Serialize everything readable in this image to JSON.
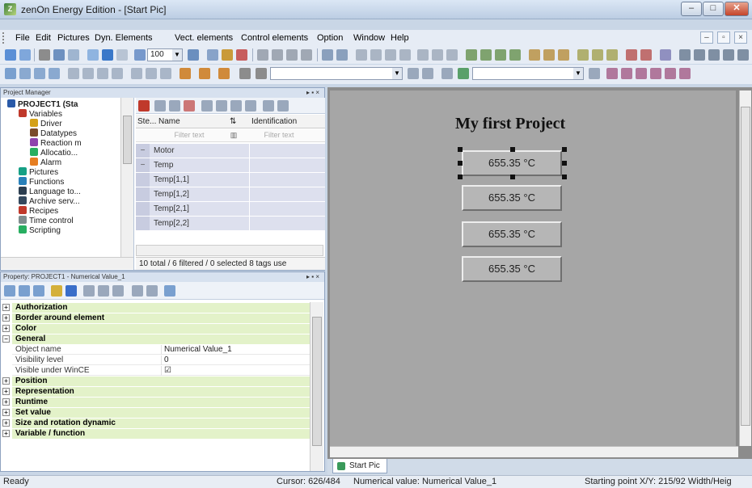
{
  "window": {
    "title": "zenOn Energy Edition - [Start Pic]",
    "app_icon_glyph": "Z",
    "minimize_glyph": "–",
    "maximize_glyph": "□",
    "close_glyph": "✕"
  },
  "menu": {
    "items": [
      "File",
      "Edit",
      "Pictures",
      "Dyn. Elements",
      "Vect. elements",
      "Control elements",
      "Option",
      "Window",
      "Help"
    ],
    "mdi": [
      "–",
      "▫",
      "×"
    ]
  },
  "toolbar": {
    "zoom_value": "100"
  },
  "project_manager": {
    "title": "Project Manager",
    "controls": "▸ ▪ ×",
    "tree": [
      {
        "label": "PROJECT1 (Sta",
        "icon": "project-icon",
        "color": "#2a5aa8",
        "bold": true
      },
      {
        "label": "Variables",
        "icon": "variables-icon",
        "color": "#c0392b"
      },
      {
        "label": "Driver",
        "icon": "driver-icon",
        "color": "#d4a017"
      },
      {
        "label": "Datatypes",
        "icon": "datatypes-icon",
        "color": "#7a4b2a"
      },
      {
        "label": "Reaction m",
        "icon": "reaction-icon",
        "color": "#8e44ad"
      },
      {
        "label": "Allocatio...",
        "icon": "allocation-icon",
        "color": "#27ae60"
      },
      {
        "label": "Alarm",
        "icon": "alarm-icon",
        "color": "#e67e22"
      },
      {
        "label": "Pictures",
        "icon": "pictures-icon",
        "color": "#16a085"
      },
      {
        "label": "Functions",
        "icon": "functions-icon",
        "color": "#2980b9"
      },
      {
        "label": "Language to...",
        "icon": "language-icon",
        "color": "#2c3e50"
      },
      {
        "label": "Archive serv...",
        "icon": "archive-icon",
        "color": "#34495e"
      },
      {
        "label": "Recipes",
        "icon": "recipes-icon",
        "color": "#c0392b"
      },
      {
        "label": "Time control",
        "icon": "clock-icon",
        "color": "#7f8c8d"
      },
      {
        "label": "Scripting",
        "icon": "scripting-icon",
        "color": "#27ae60"
      }
    ],
    "columns": [
      "Ste...",
      "Name",
      "Identification"
    ],
    "filter_placeholder": "Filter text",
    "variables": [
      "Motor",
      "Temp",
      "Temp[1,1]",
      "Temp[1,2]",
      "Temp[2,1]",
      "Temp[2,2]"
    ],
    "status": "10 total / 6 filtered / 0 selected  8 tags use"
  },
  "properties": {
    "title": "Property: PROJECT1 - Numerical Value_1",
    "controls": "▸ ▪ ×",
    "rows": [
      {
        "type": "cat",
        "label": "Authorization",
        "exp": "+"
      },
      {
        "type": "cat",
        "label": "Border around element",
        "exp": "+"
      },
      {
        "type": "cat",
        "label": "Color",
        "exp": "+"
      },
      {
        "type": "cat",
        "label": "General",
        "exp": "−"
      },
      {
        "type": "prop",
        "key": "Object name",
        "value": "Numerical Value_1"
      },
      {
        "type": "prop",
        "key": "Visibility level",
        "value": "0"
      },
      {
        "type": "prop",
        "key": "Visible under WinCE",
        "value": "☑"
      },
      {
        "type": "cat",
        "label": "Position",
        "exp": "+"
      },
      {
        "type": "cat",
        "label": "Representation",
        "exp": "+"
      },
      {
        "type": "cat",
        "label": "Runtime",
        "exp": "+"
      },
      {
        "type": "cat",
        "label": "Set value",
        "exp": "+"
      },
      {
        "type": "cat",
        "label": "Size and rotation dynamic",
        "exp": "+"
      },
      {
        "type": "cat",
        "label": "Variable / function",
        "exp": "+"
      }
    ]
  },
  "editor": {
    "picture_title": "My first Project",
    "values": [
      "655.35  °C",
      "655.35  °C",
      "655.35  °C",
      "655.35  °C"
    ],
    "tab": "Start Pic"
  },
  "statusbar": {
    "ready": "Ready",
    "cursor": "Cursor: 626/484",
    "numerical": "Numerical value: Numerical Value_1",
    "starting": "Starting point X/Y: 215/92  Width/Heig"
  }
}
